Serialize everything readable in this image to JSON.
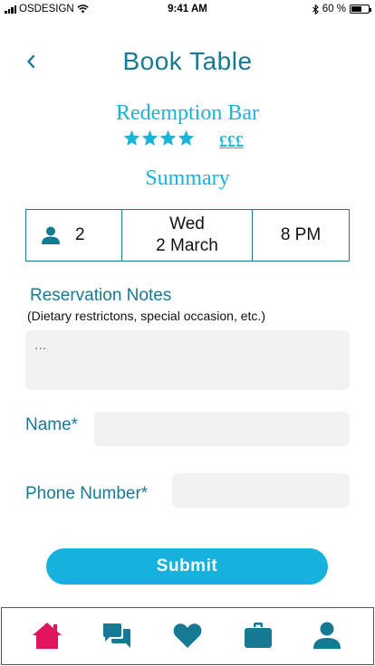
{
  "status_bar": {
    "carrier": "OSDESIGN",
    "time": "9:41 AM",
    "battery_text": "60 %",
    "battery_level": 0.6
  },
  "header": {
    "title": "Book Table",
    "back_icon": "chevron-left-icon"
  },
  "venue": {
    "name": "Redemption Bar",
    "rating": 4,
    "rating_max": 4,
    "price": "£££",
    "star_icon": "star-icon"
  },
  "summary": {
    "heading": "Summary",
    "guests": "2",
    "guests_icon": "person-icon",
    "day": "Wed",
    "date": "2 March",
    "time": "8 PM"
  },
  "notes": {
    "label": "Reservation Notes",
    "hint": "(Dietary restrictons, special occasion, etc.)",
    "placeholder": "..."
  },
  "form": {
    "name_label": "Name*",
    "name_value": "",
    "phone_label": "Phone Number*",
    "phone_value": ""
  },
  "actions": {
    "submit_label": "Submit"
  },
  "tab_bar": {
    "items": [
      {
        "name": "home",
        "icon": "home-icon",
        "active": true
      },
      {
        "name": "messages",
        "icon": "chat-icon",
        "active": false
      },
      {
        "name": "favorites",
        "icon": "heart-icon",
        "active": false
      },
      {
        "name": "bookings",
        "icon": "briefcase-icon",
        "active": false
      },
      {
        "name": "profile",
        "icon": "person-icon",
        "active": false
      }
    ]
  },
  "colors": {
    "primary": "#177a94",
    "accent": "#1ab3d9",
    "active_tab": "#e0145f",
    "button": "#16b1dc"
  }
}
